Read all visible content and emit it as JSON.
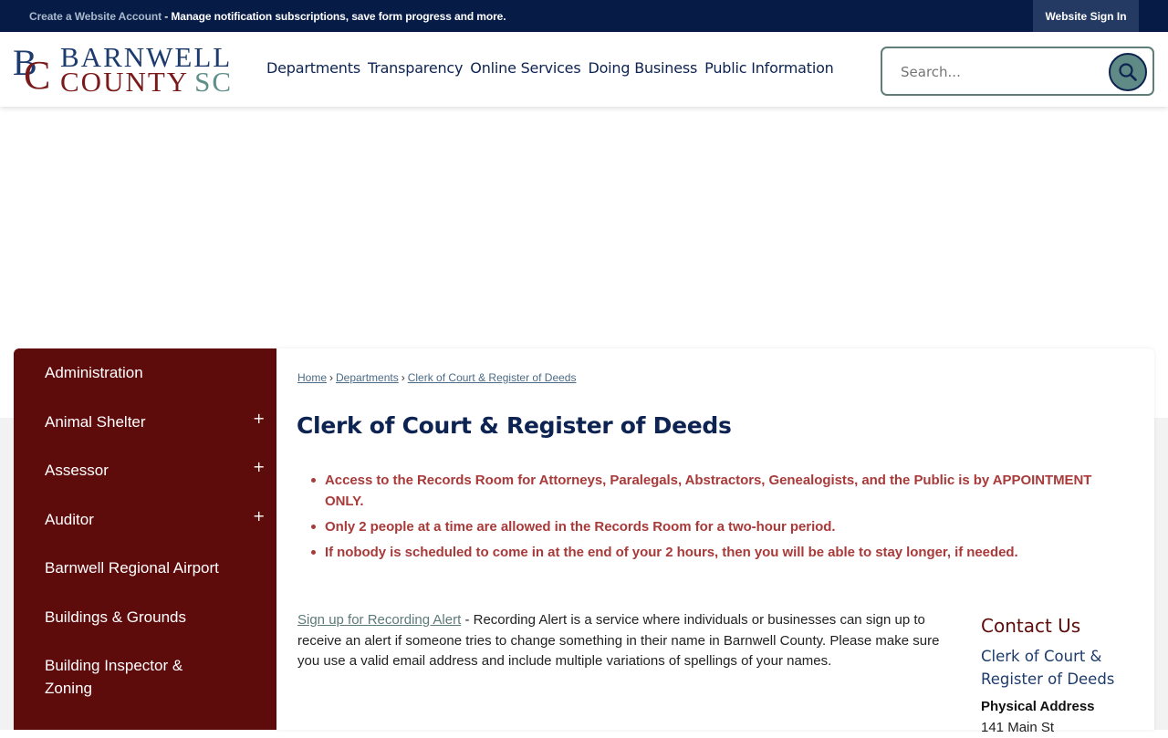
{
  "topbar": {
    "create_account_link": "Create a Website Account",
    "create_account_desc": " - Manage notification subscriptions, save form progress and more.",
    "signin_label": "Website Sign In"
  },
  "logo": {
    "initial_b": "B",
    "initial_c": "C",
    "line1": "BARNWELL",
    "line2": "COUNTY",
    "state": "SC"
  },
  "nav": {
    "items": [
      "Departments",
      "Transparency",
      "Online Services",
      "Doing Business",
      "Public Information"
    ]
  },
  "search": {
    "placeholder": "Search..."
  },
  "sidebar": {
    "items": [
      {
        "label": "Administration",
        "expandable": false
      },
      {
        "label": "Animal Shelter",
        "expandable": true
      },
      {
        "label": "Assessor",
        "expandable": true
      },
      {
        "label": "Auditor",
        "expandable": true
      },
      {
        "label": "Barnwell Regional Airport",
        "expandable": false
      },
      {
        "label": "Buildings & Grounds",
        "expandable": false
      },
      {
        "label": "Building Inspector & Zoning",
        "expandable": false
      }
    ],
    "expand_symbol": "+"
  },
  "breadcrumb": {
    "items": [
      "Home",
      "Departments",
      "Clerk of Court & Register of Deeds"
    ],
    "separator": "›"
  },
  "page": {
    "title": "Clerk of Court & Register of Deeds",
    "notices": [
      "Access to the Records Room for Attorneys, Paralegals, Abstractors, Genealogists, and the Public is by APPOINTMENT ONLY.",
      "Only 2 people at a time are allowed in the Records Room for a two-hour period.",
      "If nobody is scheduled to come in at the end of your 2 hours, then you will be able to stay longer, if needed."
    ],
    "alert_link": "Sign up for Recording Alert",
    "alert_text": " - Recording Alert is a service where individuals or businesses can sign up to receive an alert if someone tries to change something in their name in Barnwell County. Please make sure you use a valid email address and include multiple variations of spellings of your names."
  },
  "contact": {
    "heading": "Contact Us",
    "department": "Clerk of Court & Register of Deeds",
    "physical_address_label": "Physical Address",
    "street": "141 Main St"
  },
  "colors": {
    "topbar_bg": "#061b46",
    "navy": "#0d2352",
    "maroon": "#5e0b0b",
    "notice_red": "#a83a3a",
    "teal": "#5f8a86"
  }
}
